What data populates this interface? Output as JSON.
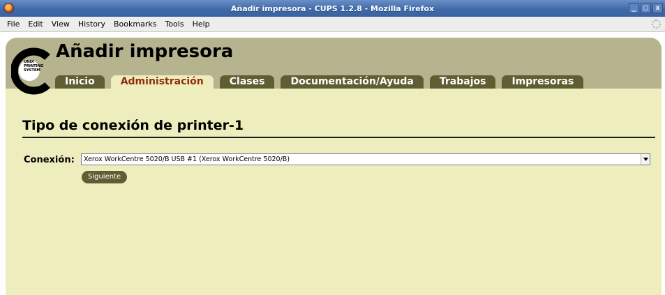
{
  "window": {
    "title": "Añadir impresora - CUPS 1.2.8 - Mozilla Firefox",
    "controls": {
      "minimize": "_",
      "maximize": "□",
      "close": "x"
    }
  },
  "menubar": {
    "items": [
      {
        "label": "File"
      },
      {
        "label": "Edit"
      },
      {
        "label": "View"
      },
      {
        "label": "History"
      },
      {
        "label": "Bookmarks"
      },
      {
        "label": "Tools"
      },
      {
        "label": "Help"
      }
    ]
  },
  "header": {
    "logo_lines": [
      "UNIX",
      "PRINTING",
      "SYSTEM"
    ],
    "title": "Añadir impresora",
    "tabs": [
      {
        "label": "Inicio"
      },
      {
        "label": "Administración"
      },
      {
        "label": "Clases"
      },
      {
        "label": "Documentación/Ayuda"
      },
      {
        "label": "Trabajos"
      },
      {
        "label": "Impresoras"
      }
    ],
    "active_tab": "Administración"
  },
  "main": {
    "section_title": "Tipo de conexión de printer-1",
    "connection_label": "Conexión:",
    "connection_value": "Xerox WorkCentre 5020/B USB #1 (Xerox WorkCentre 5020/B)",
    "next_button": "Siguiente"
  },
  "colors": {
    "title_bar": "#3f6aa8",
    "header_band": "#b6b48e",
    "page_background": "#ededbe",
    "tab_background": "#5f5d32",
    "active_tab_text": "#8f2d0c",
    "button_background": "#5f5d32"
  }
}
